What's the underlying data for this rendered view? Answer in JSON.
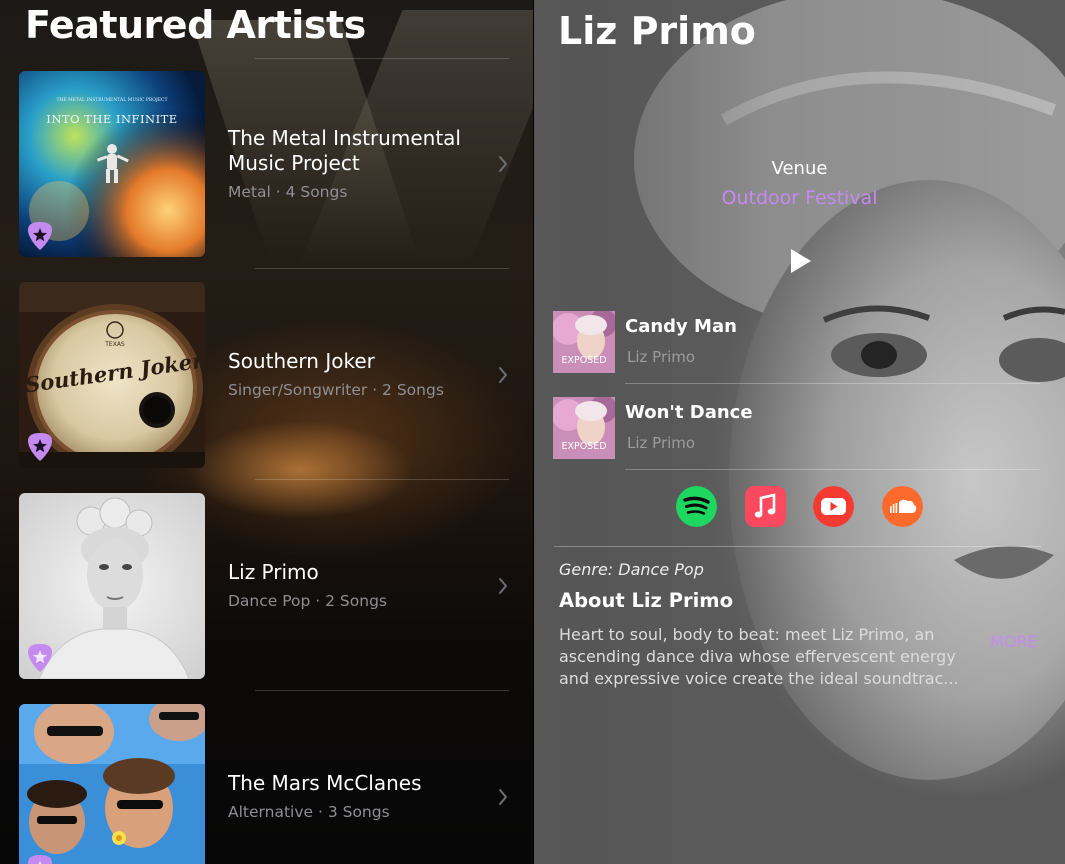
{
  "left_pane": {
    "title": "Featured Artists",
    "artists": [
      {
        "name": "The Metal Instrumental Music Project",
        "meta": "Metal · 4 Songs",
        "artwork_text": "INTO THE INFINITE",
        "artwork_subtext": "THE METAL INSTRUMENTAL MUSIC PROJECT"
      },
      {
        "name": "Southern Joker",
        "meta": "Singer/Songwriter · 2 Songs",
        "artwork_text": "Southern Joker",
        "artwork_subtext": "TEXAS"
      },
      {
        "name": "Liz Primo",
        "meta": "Dance Pop · 2 Songs"
      },
      {
        "name": "The Mars McClanes",
        "meta": "Alternative · 3 Songs"
      }
    ]
  },
  "detail": {
    "title": "Liz Primo",
    "venue_label": "Venue",
    "venue_value": "Outdoor Festival",
    "songs": [
      {
        "title": "Candy Man",
        "artist": "Liz Primo",
        "art_label": "EXPOSED"
      },
      {
        "title": "Won't Dance",
        "artist": "Liz Primo",
        "art_label": "EXPOSED"
      }
    ],
    "services": [
      "spotify-icon",
      "apple-music-icon",
      "youtube-icon",
      "soundcloud-icon"
    ],
    "genre": "Genre: Dance Pop",
    "about_title": "About Liz Primo",
    "about_text": "Heart to soul, body to beat: meet Liz Primo, an ascending dance diva whose effervescent energy and expressive voice create the ideal soundtrac...",
    "more_label": "MORE"
  },
  "colors": {
    "accent": "#c58af0",
    "spotify": "#1ed760",
    "apple_music": "#fb4a5f",
    "youtube": "#f43a31",
    "soundcloud": "#fe6a2c",
    "secondary_text": "#8e8e93"
  }
}
